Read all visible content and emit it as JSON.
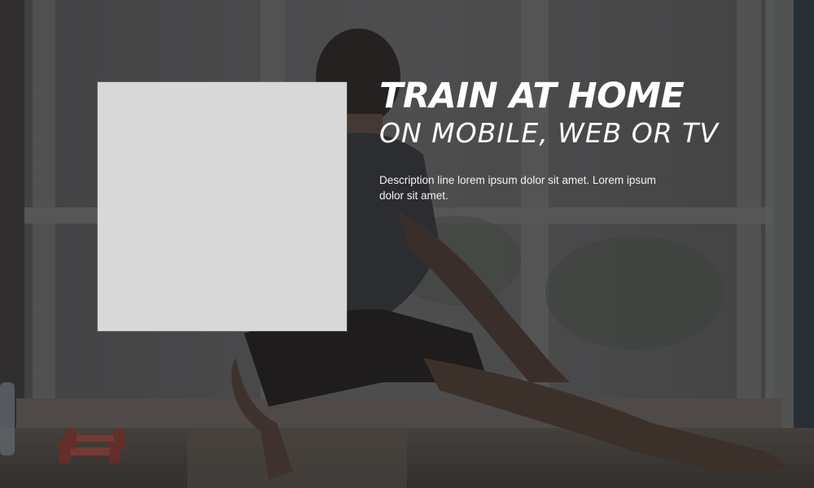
{
  "hero": {
    "title": "TRAIN AT HOME",
    "subtitle": "ON MOBILE, WEB OR TV",
    "description": "Description line lorem ipsum dolor sit amet. Lorem ipsum dolor sit amet."
  },
  "background": {
    "icon": "person-stretching-photo",
    "overlay_color": "#2b2a29",
    "placeholder_color": "#d8d8d8"
  }
}
